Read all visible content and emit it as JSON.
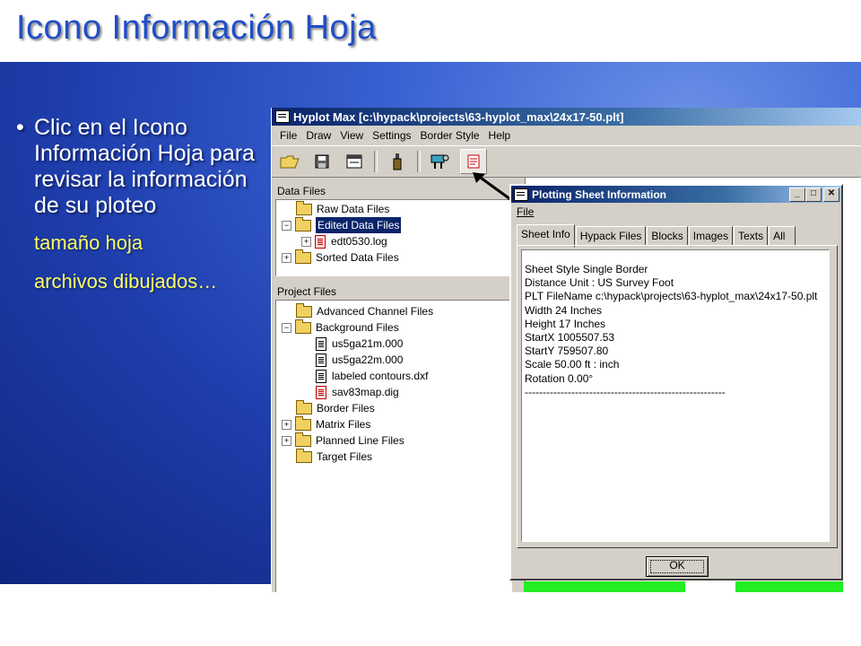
{
  "slide": {
    "title": "Icono Información Hoja",
    "bullet": "Clic en el Icono Información Hoja para revisar la información de su ploteo",
    "sub1": "tamaño hoja",
    "sub2": "archivos dibujados…"
  },
  "app": {
    "title": "Hyplot Max [c:\\hypack\\projects\\63-hyplot_max\\24x17-50.plt]",
    "menu": [
      "File",
      "Draw",
      "View",
      "Settings",
      "Border Style",
      "Help"
    ],
    "toolbar_icons": [
      "open-folder-icon",
      "save-icon",
      "sheet-style-icon",
      "bottle-icon",
      "plot-settings-icon",
      "sheet-info-icon"
    ]
  },
  "data_files": {
    "header": "Data Files",
    "items": [
      "Raw Data Files",
      "Edited Data Files",
      "edt0530.log",
      "Sorted Data Files"
    ]
  },
  "project_files": {
    "header": "Project Files",
    "items": [
      "Advanced Channel Files",
      "Background Files",
      "us5ga21m.000",
      "us5ga22m.000",
      "labeled contours.dxf",
      "sav83map.dig",
      "Border Files",
      "Matrix Files",
      "Planned Line Files",
      "Target Files"
    ]
  },
  "dialog": {
    "title": "Plotting Sheet Information",
    "menu": "File",
    "tabs": [
      "Sheet Info",
      "Hypack Files",
      "Blocks",
      "Images",
      "Texts",
      "All"
    ],
    "lines": [
      "Sheet Style Single Border",
      "Distance Unit : US Survey Foot",
      "PLT FileName c:\\hypack\\projects\\63-hyplot_max\\24x17-50.plt",
      "Width 24 Inches",
      "Height 17 Inches",
      "StartX 1005507.53",
      "StartY 759507.80",
      "Scale 50.00 ft : inch",
      "Rotation 0.00°",
      "--------------------------------------------------------"
    ],
    "ok": "OK"
  },
  "colors": {
    "title_blue": "#1f4ec8",
    "subbullet_yellow": "#ffff66",
    "titlebar_navy": "#0a246a",
    "plot_green": "#22ee22"
  }
}
